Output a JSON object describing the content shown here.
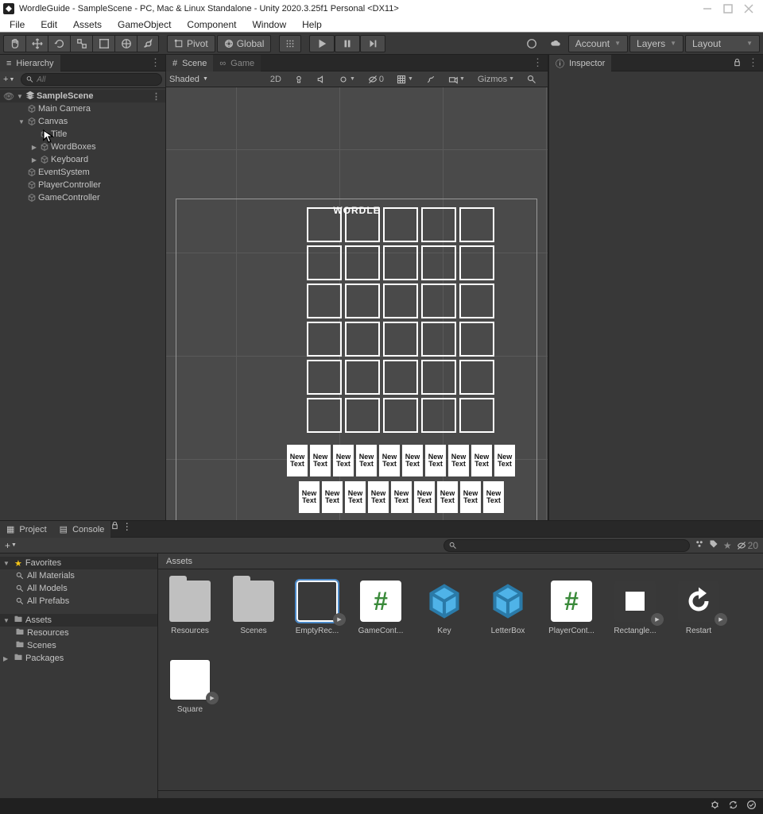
{
  "window_title": "WordleGuide - SampleScene - PC, Mac & Linux Standalone - Unity 2020.3.25f1 Personal <DX11>",
  "menu": [
    "File",
    "Edit",
    "Assets",
    "GameObject",
    "Component",
    "Window",
    "Help"
  ],
  "toolbar": {
    "pivot": "Pivot",
    "global": "Global",
    "account": "Account",
    "layers": "Layers",
    "layout": "Layout"
  },
  "hierarchy": {
    "title": "Hierarchy",
    "search_placeholder": "All",
    "items": [
      {
        "label": "SampleScene",
        "depth": 0,
        "expanded": true,
        "scene": true,
        "selected": false,
        "kebab": true
      },
      {
        "label": "Main Camera",
        "depth": 1
      },
      {
        "label": "Canvas",
        "depth": 1,
        "expanded": true,
        "hasChildren": true
      },
      {
        "label": "Title",
        "depth": 2,
        "selected": false,
        "showCursor": true
      },
      {
        "label": "WordBoxes",
        "depth": 2,
        "hasChildren": true,
        "collapsed": true
      },
      {
        "label": "Keyboard",
        "depth": 2,
        "hasChildren": true,
        "collapsed": true
      },
      {
        "label": "EventSystem",
        "depth": 1
      },
      {
        "label": "PlayerController",
        "depth": 1
      },
      {
        "label": "GameController",
        "depth": 1
      }
    ]
  },
  "scene": {
    "tab_scene": "Scene",
    "tab_game": "Game",
    "shading": "Shaded",
    "gizmos": "Gizmos",
    "2d": "2D",
    "wordle_title": "WORDLE",
    "key_label": "New\nText"
  },
  "inspector": {
    "title": "Inspector"
  },
  "project": {
    "tab_project": "Project",
    "tab_console": "Console",
    "hidden_count": "20",
    "breadcrumb": "Assets",
    "left_tree": {
      "favorites": "Favorites",
      "fav_items": [
        "All Materials",
        "All Models",
        "All Prefabs"
      ],
      "assets": "Assets",
      "asset_folders": [
        "Resources",
        "Scenes"
      ],
      "packages": "Packages"
    },
    "assets": [
      {
        "name": "Resources",
        "type": "folder"
      },
      {
        "name": "Scenes",
        "type": "folder"
      },
      {
        "name": "EmptyRec...",
        "type": "empty-rect",
        "play": true,
        "selected": true
      },
      {
        "name": "GameCont...",
        "type": "script"
      },
      {
        "name": "Key",
        "type": "cube"
      },
      {
        "name": "LetterBox",
        "type": "cube"
      },
      {
        "name": "PlayerCont...",
        "type": "script"
      },
      {
        "name": "Rectangle...",
        "type": "white-sm",
        "play": true
      },
      {
        "name": "Restart",
        "type": "restart",
        "play": true
      },
      {
        "name": "Square",
        "type": "white",
        "play": true
      }
    ]
  }
}
